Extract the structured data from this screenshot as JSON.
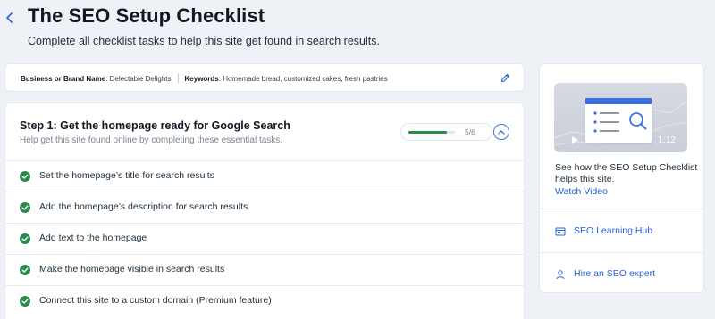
{
  "header": {
    "title": "The SEO Setup Checklist",
    "subtitle": "Complete all checklist tasks to help this site get found in search results."
  },
  "business": {
    "name_label": "Business or Brand Name",
    "name_value": ": Delectable Delights",
    "keywords_label": "Keywords",
    "keywords_value": ": Homemade bread, customized cakes, fresh pastries"
  },
  "step": {
    "title": "Step 1: Get the homepage ready for Google Search",
    "description": "Help get this site found online by completing these essential tasks.",
    "progress_text": "5/6",
    "progress_fraction": 0.833
  },
  "tasks": [
    {
      "label": "Set the homepage’s title for search results",
      "done": true
    },
    {
      "label": "Add the homepage’s description for search results",
      "done": true
    },
    {
      "label": "Add text to the homepage",
      "done": true
    },
    {
      "label": "Make the homepage visible in search results",
      "done": true
    },
    {
      "label": "Connect this site to a custom domain (Premium feature)",
      "done": true
    }
  ],
  "sidebar": {
    "video_duration": "1:12",
    "video_caption": "See how the SEO Setup Checklist helps this site.",
    "watch_label": "Watch Video",
    "links": [
      {
        "label": "SEO Learning Hub",
        "icon": "learning-hub-icon"
      },
      {
        "label": "Hire an SEO expert",
        "icon": "expert-icon"
      }
    ]
  },
  "colors": {
    "accent_blue": "#2b62d9",
    "success_green": "#2b8a4a",
    "background": "#eef1f6"
  }
}
